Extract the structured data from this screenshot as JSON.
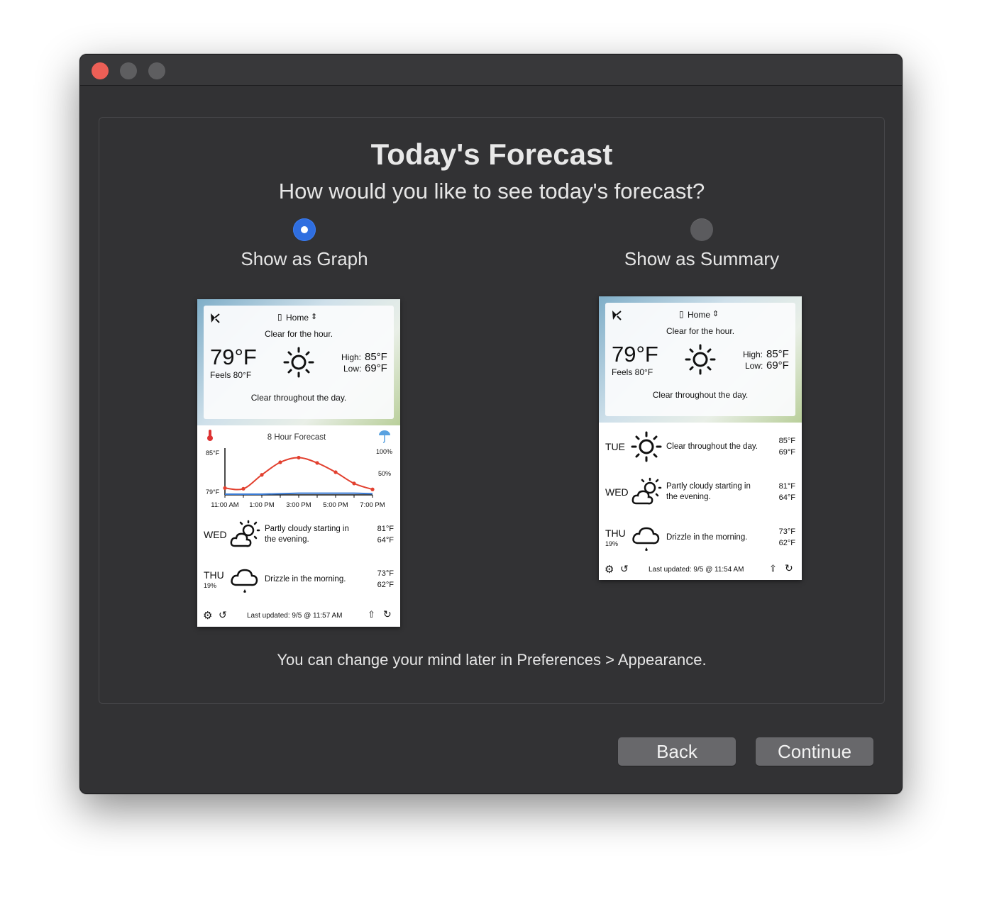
{
  "dialog": {
    "title": "Today's Forecast",
    "subtitle": "How would you like to see today's forecast?",
    "footer_note": "You can change your mind later in Preferences > Appearance.",
    "back_label": "Back",
    "continue_label": "Continue"
  },
  "options": [
    {
      "label": "Show as Graph",
      "selected": true
    },
    {
      "label": "Show as Summary",
      "selected": false
    }
  ],
  "colors": {
    "accent": "#2f6ee0",
    "window_bg": "#323234",
    "close": "#ec5f56",
    "chart_line": "#e2402f",
    "precip_line": "#3a7bd5"
  },
  "graph_preview": {
    "location": "Home",
    "hour_summary": "Clear for the hour.",
    "temp": "79°F",
    "feels": "Feels 80°F",
    "high_label": "High:",
    "high": "85°F",
    "low_label": "Low:",
    "low": "69°F",
    "day_summary": "Clear throughout the day.",
    "chart_title": "8 Hour Forecast",
    "last_updated": "Last updated: 9/5 @ 11:57 AM",
    "days": [
      {
        "day": "WED",
        "pct": "",
        "icon": "partly-cloudy-icon",
        "summary": "Partly cloudy starting in",
        "summary2": "the evening.",
        "high": "81°F",
        "low": "64°F"
      },
      {
        "day": "THU",
        "pct": "19%",
        "icon": "drizzle-icon",
        "summary": "Drizzle in the morning.",
        "summary2": "",
        "high": "73°F",
        "low": "62°F"
      }
    ]
  },
  "summary_preview": {
    "location": "Home",
    "hour_summary": "Clear for the hour.",
    "temp": "79°F",
    "feels": "Feels 80°F",
    "high_label": "High:",
    "high": "85°F",
    "low_label": "Low:",
    "low": "69°F",
    "day_summary": "Clear throughout the day.",
    "last_updated": "Last updated: 9/5 @ 11:54 AM",
    "days": [
      {
        "day": "TUE",
        "pct": "",
        "icon": "sun-icon",
        "summary": "Clear throughout the day.",
        "summary2": "",
        "high": "85°F",
        "low": "69°F"
      },
      {
        "day": "WED",
        "pct": "",
        "icon": "partly-cloudy-icon",
        "summary": "Partly cloudy starting in",
        "summary2": "the evening.",
        "high": "81°F",
        "low": "64°F"
      },
      {
        "day": "THU",
        "pct": "19%",
        "icon": "drizzle-icon",
        "summary": "Drizzle in the morning.",
        "summary2": "",
        "high": "73°F",
        "low": "62°F"
      }
    ]
  },
  "chart_data": {
    "type": "line",
    "title": "8 Hour Forecast",
    "x": [
      "11:00 AM",
      "12:00 PM",
      "1:00 PM",
      "2:00 PM",
      "3:00 PM",
      "4:00 PM",
      "5:00 PM",
      "6:00 PM",
      "7:00 PM"
    ],
    "xtick_labels": [
      "11:00 AM",
      "1:00 PM",
      "3:00 PM",
      "5:00 PM",
      "7:00 PM"
    ],
    "ylabels": {
      "left_top": "85°F",
      "left_bottom": "79°F",
      "right_top": "100%",
      "right_mid": "50%"
    },
    "series": [
      {
        "values": [
          79.6,
          79.5,
          81.6,
          83.5,
          84.2,
          83.4,
          82.0,
          80.3,
          79.4
        ]
      },
      {
        "values": [
          0,
          0,
          0,
          1,
          2,
          2,
          2,
          2,
          1
        ]
      }
    ],
    "ylim": [
      79,
      85
    ],
    "y2lim": [
      0,
      100
    ]
  }
}
